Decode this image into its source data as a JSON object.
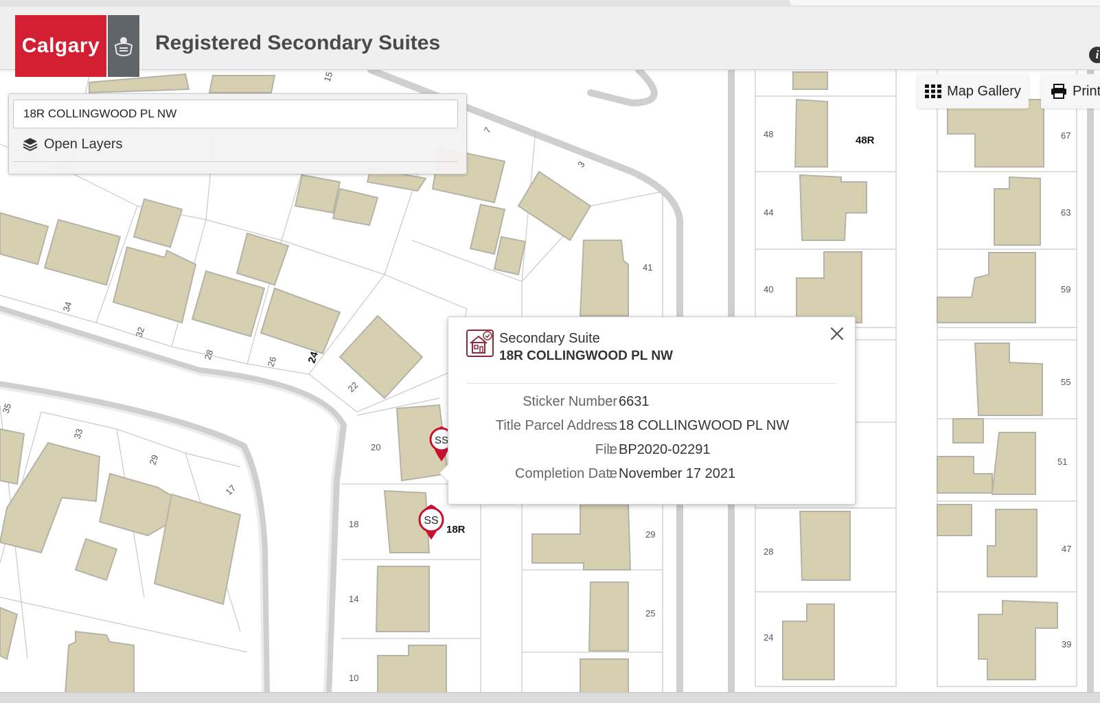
{
  "header": {
    "logo_text": "Calgary",
    "title": "Registered Secondary Suites",
    "info_icon_glyph": "i",
    "brand_color": "#d21f32"
  },
  "search": {
    "value": "18R COLLINGWOOD PL NW",
    "open_layers_label": "Open Layers",
    "layers_icon": "layers-icon"
  },
  "tools": {
    "map_gallery_label": "Map Gallery",
    "map_gallery_icon": "grid-icon",
    "print_label": "Print",
    "print_icon": "printer-icon"
  },
  "popup": {
    "type_label": "Secondary Suite",
    "address": "18R COLLINGWOOD PL NW",
    "icon": "secondary-suite-house-icon",
    "fields": [
      {
        "key": "Sticker Number",
        "value": "6631"
      },
      {
        "key": "Title Parcel Address",
        "value": "18 COLLINGWOOD PL NW"
      },
      {
        "key": "File",
        "value": "BP2020-02291"
      },
      {
        "key": "Completion Date",
        "value": "November 17 2021"
      }
    ]
  },
  "map": {
    "building_color": "#d6d0b0",
    "road_color": "#d8d8d8",
    "lot_labels": [
      "15",
      "7",
      "3",
      "41",
      "34",
      "32",
      "28",
      "26",
      "24",
      "22",
      "20",
      "18",
      "14",
      "10",
      "35",
      "33",
      "29",
      "17",
      "29",
      "25",
      "48",
      "48R",
      "44",
      "40",
      "28",
      "24",
      "67",
      "63",
      "59",
      "55",
      "51",
      "47",
      "39"
    ],
    "markers": [
      {
        "label": "SS",
        "tag": ""
      },
      {
        "label": "SS",
        "tag": "18R"
      }
    ]
  }
}
